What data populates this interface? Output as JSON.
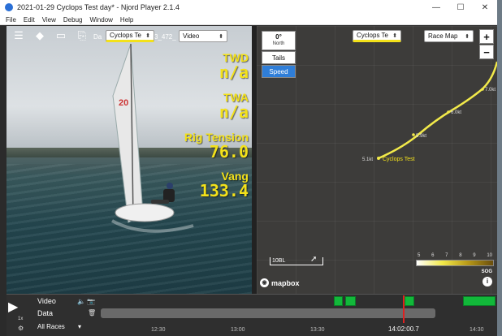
{
  "window": {
    "title": "2021-01-29 Cyclops Test day* - Njord Player 2.1.4",
    "controls": [
      "—",
      "☐",
      "✕"
    ]
  },
  "menu": [
    "File",
    "Edit",
    "View",
    "Debug",
    "Window",
    "Help"
  ],
  "video_panel": {
    "toolbar_icons": [
      "sliders-icon",
      "diamond-arrows-icon",
      "monitor-icon",
      "export-icon"
    ],
    "data_label": "Da",
    "boat_select": "Cyclops Te",
    "partial_label": "3_472_",
    "source_select": "Video",
    "metrics": [
      {
        "label": "TWD",
        "value": "n/a"
      },
      {
        "label": "TWA",
        "value": "n/a"
      },
      {
        "label": "Rig Tension",
        "value": "76.0"
      },
      {
        "label": "Vang",
        "value": "133.4"
      }
    ]
  },
  "map_panel": {
    "north": {
      "degrees": "0°",
      "label": "North"
    },
    "tails_label": "Tails",
    "speed_label": "Speed",
    "boat_select": "Cyclops Te",
    "map_select": "Race Map",
    "zoom_in": "+",
    "zoom_out": "−",
    "track": {
      "boat_name": "Cyclops Test",
      "speed_labels": [
        "5.1kt",
        "5.9kt",
        "6.0kt",
        "7.0kt"
      ]
    },
    "scale_label": "10BL",
    "attribution": "mapbox",
    "sog_legend": {
      "title": "SOG",
      "ticks": [
        "5",
        "6",
        "7",
        "8",
        "9",
        "10"
      ]
    },
    "colors": {
      "speed_button": "#2f7ed8",
      "track": "#f2ea4a",
      "metric_text": "#f3e11a"
    }
  },
  "timeline": {
    "rows": [
      "Video",
      "Data"
    ],
    "races_select": "All Races",
    "speed": "1x",
    "time_ticks": [
      "12:30",
      "13:00",
      "13:30",
      "14:30"
    ],
    "current_time": "14:02:00.7",
    "video_segment_color": "#12b83a",
    "playhead_color": "#e02020"
  }
}
